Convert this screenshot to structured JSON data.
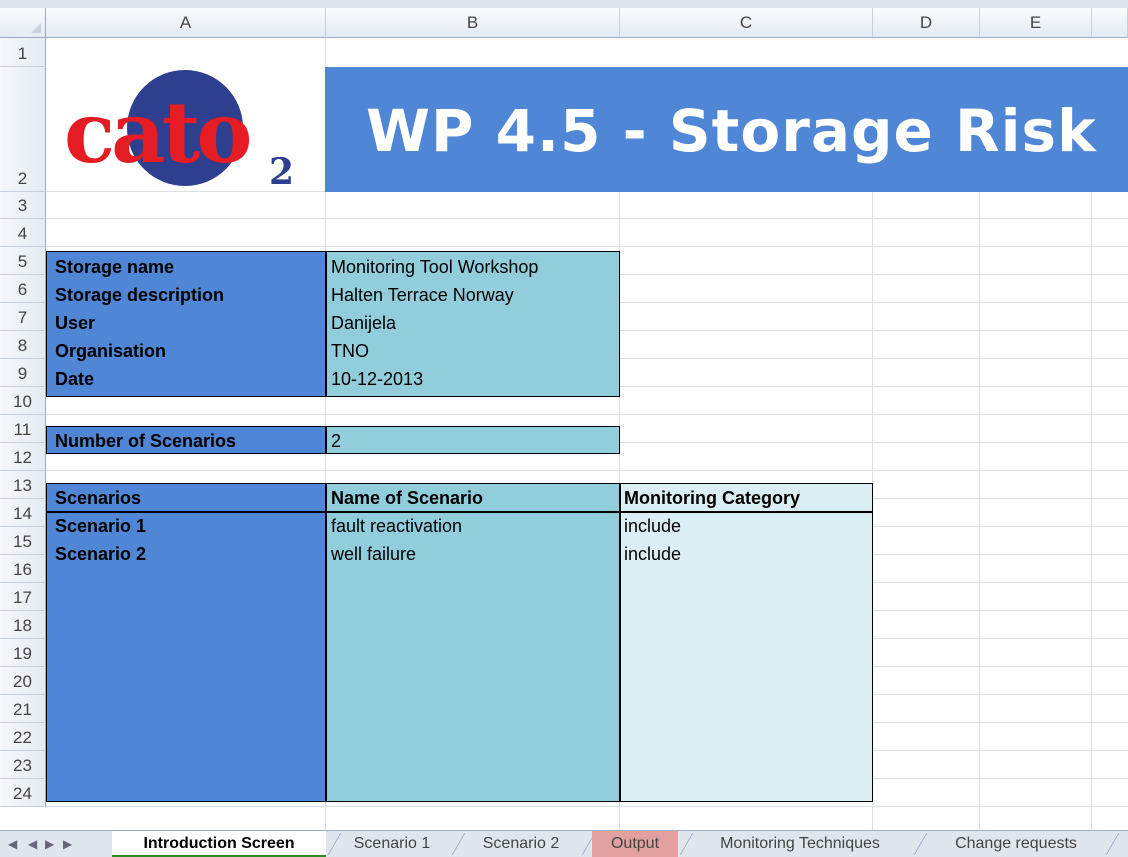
{
  "columns": [
    "A",
    "B",
    "C",
    "D",
    "E"
  ],
  "rows": [
    "1",
    "2",
    "3",
    "4",
    "5",
    "6",
    "7",
    "8",
    "9",
    "10",
    "11",
    "12",
    "13",
    "14",
    "15",
    "16",
    "17",
    "18",
    "19",
    "20",
    "21",
    "22",
    "23",
    "24"
  ],
  "logo": {
    "text": "cato",
    "subscript": "2"
  },
  "banner": {
    "title": "WP 4.5 - Storage Risk",
    "color": "#4f86d6"
  },
  "info": [
    {
      "label": "Storage name",
      "value": "Monitoring Tool Workshop"
    },
    {
      "label": "Storage description",
      "value": "Halten Terrace Norway"
    },
    {
      "label": "User",
      "value": "Danijela"
    },
    {
      "label": "Organisation",
      "value": "TNO"
    },
    {
      "label": "Date",
      "value": "10-12-2013"
    }
  ],
  "scenario_count": {
    "label": "Number of Scenarios",
    "value": "2"
  },
  "scenario_table": {
    "headers": [
      "Scenarios",
      "Name of Scenario",
      "Monitoring Category"
    ],
    "rows": [
      {
        "id": "Scenario 1",
        "name": "fault reactivation",
        "category": "include"
      },
      {
        "id": "Scenario 2",
        "name": "well failure",
        "category": "include"
      }
    ]
  },
  "colors": {
    "label_fill": "#4f86d6",
    "value_fill": "#92cddc",
    "category_fill": "#daeef3"
  },
  "tabs": [
    "Introduction Screen",
    "Scenario 1",
    "Scenario 2",
    "Output",
    "Monitoring Techniques",
    "Change requests"
  ],
  "active_tab": "Introduction Screen"
}
